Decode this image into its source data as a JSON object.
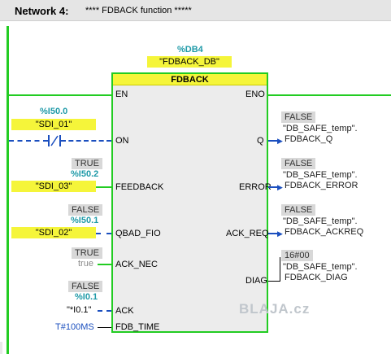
{
  "network": {
    "title": "Network 4:",
    "comment": "**** FDBACK function *****"
  },
  "block": {
    "instance_address": "%DB4",
    "instance_name": "\"FDBACK_DB\"",
    "type": "FDBACK",
    "en": "EN",
    "eno": "ENO"
  },
  "inputs": {
    "on": {
      "pin": "ON",
      "address": "%I50.0",
      "name": "\"SDI_01\""
    },
    "feedback": {
      "pin": "FEEDBACK",
      "value": "TRUE",
      "address": "%I50.2",
      "name": "\"SDI_03\""
    },
    "qbad_fio": {
      "pin": "QBAD_FIO",
      "value": "FALSE",
      "address": "%I50.1",
      "name": "\"SDI_02\""
    },
    "ack_nec": {
      "pin": "ACK_NEC",
      "value": "TRUE",
      "constant": "true"
    },
    "ack": {
      "pin": "ACK",
      "value": "FALSE",
      "address": "%I0.1",
      "name": "\"*I0.1\""
    },
    "fdb_time": {
      "pin": "FDB_TIME",
      "constant": "T#100MS"
    }
  },
  "outputs": {
    "q": {
      "pin": "Q",
      "value": "FALSE",
      "line1": "\"DB_SAFE_temp\".",
      "line2": "FDBACK_Q"
    },
    "error": {
      "pin": "ERROR",
      "value": "FALSE",
      "line1": "\"DB_SAFE_temp\".",
      "line2": "FDBACK_ERROR"
    },
    "ack_req": {
      "pin": "ACK_REQ",
      "value": "FALSE",
      "line1": "\"DB_SAFE_temp\".",
      "line2": "FDBACK_ACKREQ"
    },
    "diag": {
      "pin": "DIAG",
      "value": "16#00",
      "line1": "\"DB_SAFE_temp\".",
      "line2": "FDBACK_DIAG"
    }
  },
  "watermark": "BLAJA.cz",
  "colors": {
    "energized": "#22cc22",
    "not_energized": "#1b4fbf",
    "highlight": "#f5f53a",
    "address": "#1f9aa8",
    "block_bg": "#ececec"
  }
}
